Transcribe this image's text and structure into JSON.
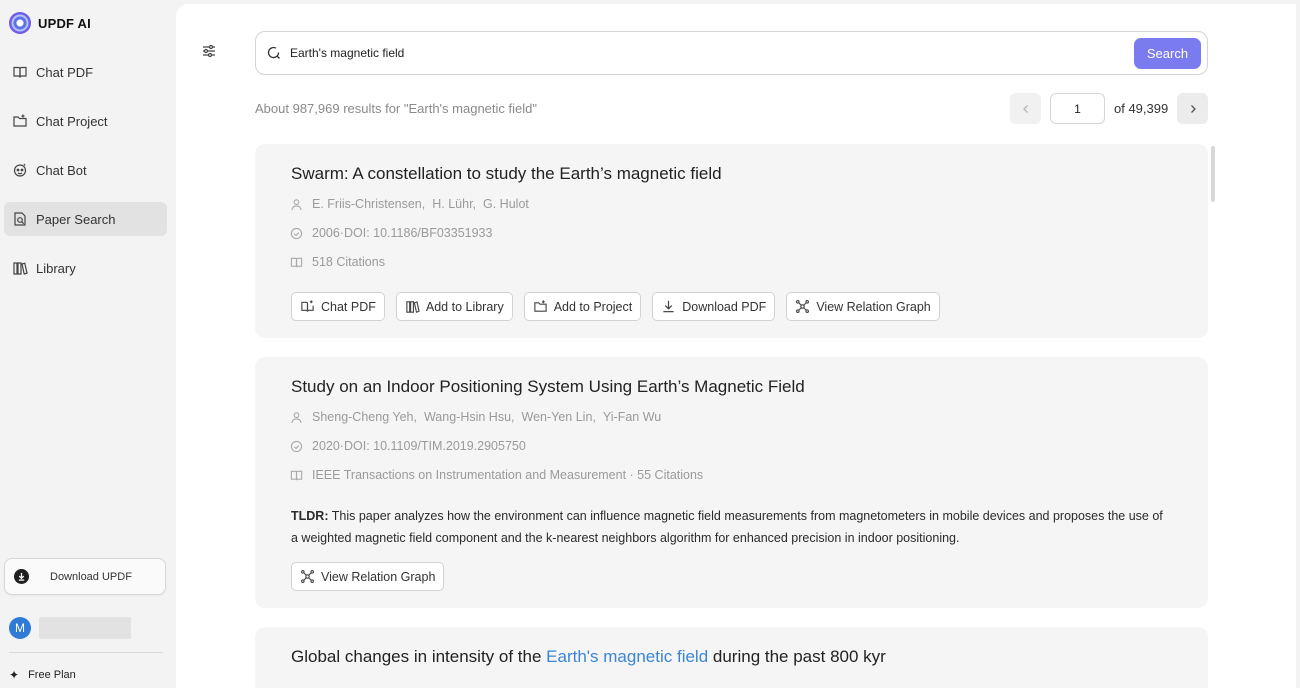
{
  "app": {
    "name": "UPDF AI"
  },
  "sidebar": {
    "items": [
      {
        "label": "Chat PDF",
        "icon": "book-open-icon"
      },
      {
        "label": "Chat Project",
        "icon": "folder-chat-icon"
      },
      {
        "label": "Chat Bot",
        "icon": "bot-icon"
      },
      {
        "label": "Paper Search",
        "icon": "doc-search-icon",
        "active": true
      },
      {
        "label": "Library",
        "icon": "library-icon"
      }
    ],
    "download_label": "Download UPDF",
    "avatar_letter": "M",
    "plan_label": "Free Plan"
  },
  "search": {
    "query": "Earth's magnetic field",
    "button_label": "Search"
  },
  "results": {
    "summary": "About 987,969 results for \"Earth's magnetic field\"",
    "current_page": "1",
    "total_pages_label": "of 49,399"
  },
  "papers": [
    {
      "title": "Swarm: A constellation to study the Earth’s magnetic field",
      "authors": [
        "E. Friis-Christensen,",
        "H. Lühr,",
        "G. Hulot"
      ],
      "date_doi": "2006·DOI: 10.1186/BF03351933",
      "venue": "518 Citations",
      "actions": [
        "Chat PDF",
        "Add to Library",
        "Add to Project",
        "Download PDF",
        "View Relation Graph"
      ]
    },
    {
      "title": "Study on an Indoor Positioning System Using Earth’s Magnetic Field",
      "authors": [
        "Sheng-Cheng Yeh,",
        "Wang-Hsin Hsu,",
        "Wen-Yen Lin,",
        "Yi-Fan Wu"
      ],
      "date_doi": "2020·DOI: 10.1109/TIM.2019.2905750",
      "venue": "IEEE Transactions on Instrumentation and Measurement · 55 Citations",
      "tldr_label": "TLDR:",
      "tldr_text": "This paper analyzes how the environment can influence magnetic field measurements from magnetometers in mobile devices and proposes the use of a weighted magnetic field component and the k-nearest neighbors algorithm for enhanced precision in indoor positioning.",
      "actions": [
        "View Relation Graph"
      ]
    },
    {
      "title_prefix": "Global changes in intensity of the ",
      "title_highlight": "Earth's magnetic field",
      "title_suffix": " during the past 800 kyr"
    }
  ],
  "colors": {
    "accent": "#7b7bf0",
    "highlight_link": "#3a86d4",
    "card_bg": "#f5f5f5",
    "sidebar_bg": "#f3f3f3",
    "avatar": "#2f7bd6"
  }
}
